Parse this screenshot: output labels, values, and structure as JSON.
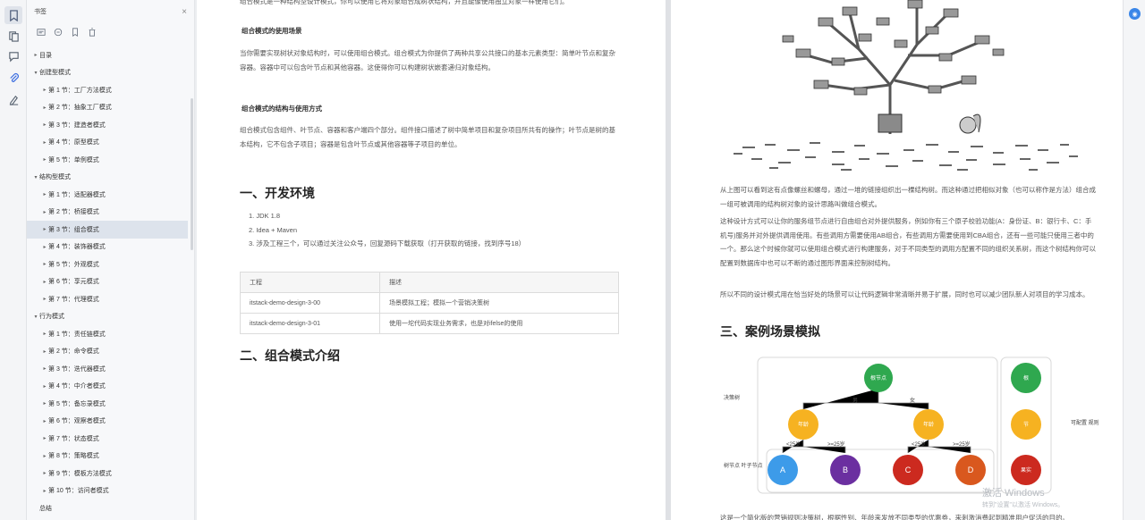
{
  "sidebar": {
    "title": "书签",
    "close": "×",
    "outline": [
      {
        "label": "目录",
        "level": 0,
        "arrow": "▸"
      },
      {
        "label": "创建型模式",
        "level": 0,
        "arrow": "▾"
      },
      {
        "label": "第 1 节：工厂方法模式",
        "level": 1,
        "arrow": "▸"
      },
      {
        "label": "第 2 节：抽象工厂模式",
        "level": 1,
        "arrow": "▸"
      },
      {
        "label": "第 3 节：建造者模式",
        "level": 1,
        "arrow": "▸"
      },
      {
        "label": "第 4 节：原型模式",
        "level": 1,
        "arrow": "▸"
      },
      {
        "label": "第 5 节：单例模式",
        "level": 1,
        "arrow": "▸"
      },
      {
        "label": "结构型模式",
        "level": 0,
        "arrow": "▾"
      },
      {
        "label": "第 1 节：适配器模式",
        "level": 1,
        "arrow": "▸"
      },
      {
        "label": "第 2 节：桥接模式",
        "level": 1,
        "arrow": "▸"
      },
      {
        "label": "第 3 节：组合模式",
        "level": 1,
        "arrow": "▸",
        "selected": true
      },
      {
        "label": "第 4 节：装饰器模式",
        "level": 1,
        "arrow": "▸"
      },
      {
        "label": "第 5 节：外观模式",
        "level": 1,
        "arrow": "▸"
      },
      {
        "label": "第 6 节：享元模式",
        "level": 1,
        "arrow": "▸"
      },
      {
        "label": "第 7 节：代理模式",
        "level": 1,
        "arrow": "▸"
      },
      {
        "label": "行为模式",
        "level": 0,
        "arrow": "▾"
      },
      {
        "label": "第 1 节：责任链模式",
        "level": 1,
        "arrow": "▸"
      },
      {
        "label": "第 2 节：命令模式",
        "level": 1,
        "arrow": "▸"
      },
      {
        "label": "第 3 节：迭代器模式",
        "level": 1,
        "arrow": "▸"
      },
      {
        "label": "第 4 节：中介者模式",
        "level": 1,
        "arrow": "▸"
      },
      {
        "label": "第 5 节：备忘录模式",
        "level": 1,
        "arrow": "▸"
      },
      {
        "label": "第 6 节：观察者模式",
        "level": 1,
        "arrow": "▸"
      },
      {
        "label": "第 7 节：状态模式",
        "level": 1,
        "arrow": "▸"
      },
      {
        "label": "第 8 节：策略模式",
        "level": 1,
        "arrow": "▸"
      },
      {
        "label": "第 9 节：模板方法模式",
        "level": 1,
        "arrow": "▸"
      },
      {
        "label": "第 10 节：访问者模式",
        "level": 1,
        "arrow": "▸"
      },
      {
        "label": "总结",
        "level": 0,
        "arrow": ""
      }
    ]
  },
  "pageLeft": {
    "intro_tail": "组合模式是一种结构型设计模式，你可以使用它将对象组合成树状结构，并且能像使用独立对象一样使用它们。",
    "sub1": "组合模式的使用场景",
    "para1": "当你需要实现树状对象结构时，可以使用组合模式。组合模式为你提供了两种共享公共接口的基本元素类型：简单叶节点和复杂容器。容器中可以包含叶节点和其他容器。这使得你可以构建树状嵌套递归对象结构。",
    "sub2": "组合模式的结构与使用方式",
    "para2": "组合模式包含组件、叶节点、容器和客户端四个部分。组件接口描述了树中简单项目和复杂项目所共有的操作；叶节点是树的基本结构，它不包含子项目；容器是包含叶节点或其他容器等子项目的单位。",
    "h_env": "一、开发环境",
    "env_items": [
      "1. JDK 1.8",
      "2. Idea + Maven",
      "3. 涉及工程三个，可以通过关注公众号，回复源码下载获取（打开获取的链接，找到序号18）"
    ],
    "table": {
      "headers": [
        "工程",
        "描述"
      ],
      "rows": [
        [
          "itstack-demo-design-3-00",
          "场景模拟工程；模拟一个营销决策树"
        ],
        [
          "itstack-demo-design-3-01",
          "使用一坨代码实现业务需求，也是对ifelse的使用"
        ]
      ]
    },
    "h_intro": "二、组合模式介绍"
  },
  "pageRight": {
    "para1": "从上图可以看到这有点像螺丝和螺母，通过一堆的链接组织出一棵结构树。而这种通过把相似对象（也可以称作是方法）组合成一组可被调用的结构树对象的设计思路叫做组合模式。",
    "para2": "这种设计方式可以让你的服务组节点进行自由组合对外提供服务，例如你有三个原子校验功能(A：身份证、B：银行卡、C：手机号)服务并对外提供调用使用。有些调用方需要使用AB组合，有些调用方需要使用到CBA组合，还有一些可能只使用三者中的一个。那么这个时候你就可以使用组合模式进行构建服务，对于不同类型的调用方配置不同的组织关系树，而这个树结构你可以配置到数据库中也可以不断的通过图形界面来控制树结构。",
    "para3": "所以不同的设计模式用在恰当好处的场景可以让代码逻辑非常清晰并易于扩展，同时也可以减少团队新人对项目的学习成本。",
    "h_case": "三、案例场景模拟",
    "diagram": {
      "left_top": "决策树",
      "left_bottom": "树节点\n叶子节点",
      "right": "可配置\n规则",
      "root": "根节点",
      "edge_left": "男",
      "edge_right": "女",
      "mid_left": "年龄",
      "mid_right": "年龄",
      "leaves": [
        "A",
        "B",
        "C",
        "D"
      ],
      "edge_labels": [
        "<25岁",
        ">=25岁",
        "<25岁",
        ">=25岁"
      ],
      "legend": [
        "根",
        "节",
        "果实"
      ]
    },
    "bottom_text": "这是一个简化版的营销规则决策树，根据性别、年龄来发放不同类型的优惠券，来刺激消费起到精准用户促活的目的。"
  },
  "watermark": {
    "line1": "激活 Windows",
    "line2": "转到\"设置\"以激活 Windows。"
  },
  "colors": {
    "green": "#2fa84f",
    "yellow": "#f6b221",
    "blue": "#3d9be9",
    "purple": "#6b2fa0",
    "red": "#cc2a1f",
    "orange": "#d9581e"
  }
}
